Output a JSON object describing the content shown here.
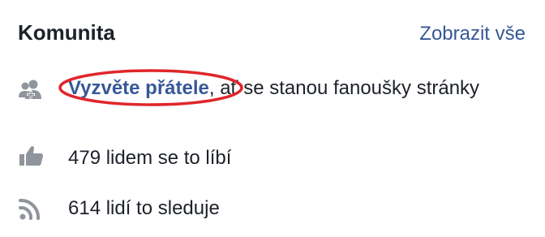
{
  "community": {
    "title": "Komunita",
    "see_all_label": "Zobrazit vše",
    "invite": {
      "icon": "invite-friends-icon",
      "link_label": "Vyzvěte přátele",
      "rest_text": ", ať se stanou fanoušky stránky",
      "highlight_color": "#e0262b"
    },
    "likes": {
      "icon": "thumbs-up-icon",
      "text": "479 lidem se to líbí"
    },
    "follows": {
      "icon": "rss-feed-icon",
      "text": "614 lidí to sleduje"
    }
  },
  "colors": {
    "link": "#365899",
    "text": "#1d2129",
    "icon": "#90949c"
  }
}
